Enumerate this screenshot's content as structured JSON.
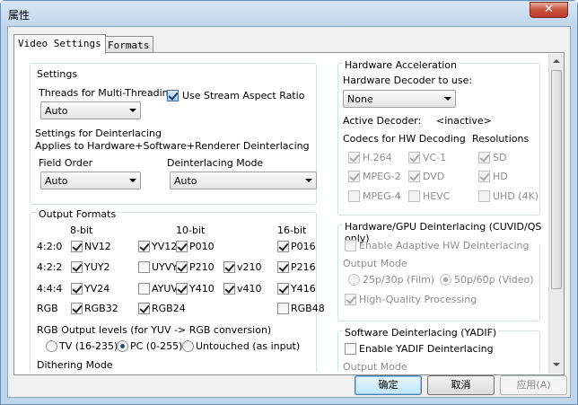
{
  "window": {
    "title": "属性",
    "close_glyph": "✕"
  },
  "tabs": [
    {
      "label": "Video Settings",
      "active": true
    },
    {
      "label": "Formats",
      "active": false
    }
  ],
  "settings": {
    "heading": "Settings",
    "threads_label": "Threads for Multi-Threading",
    "threads_value": "Auto",
    "stream_aspect_label": "Use Stream Aspect Ratio",
    "stream_aspect_checked": true,
    "deint_line1": "Settings for Deinterlacing",
    "deint_line2": "Applies to Hardware+Software+Renderer Deinterlacing",
    "field_order_label": "Field Order",
    "field_order_value": "Auto",
    "deint_mode_label": "Deinterlacing Mode",
    "deint_mode_value": "Auto"
  },
  "output_formats": {
    "heading": "Output Formats",
    "col_8bit": "8-bit",
    "col_10bit": "10-bit",
    "col_16bit": "16-bit",
    "rows": [
      {
        "label": "4:2:0",
        "items": [
          {
            "name": "NV12",
            "checked": true
          },
          {
            "name": "YV12",
            "checked": true
          },
          {
            "name": "P010",
            "checked": true
          },
          {
            "name": "P016",
            "checked": true
          }
        ]
      },
      {
        "label": "4:2:2",
        "items": [
          {
            "name": "YUY2",
            "checked": true
          },
          {
            "name": "UYVY",
            "checked": false
          },
          {
            "name": "P210",
            "checked": true
          },
          {
            "name": "v210",
            "checked": true
          },
          {
            "name": "P216",
            "checked": true
          }
        ]
      },
      {
        "label": "4:4:4",
        "items": [
          {
            "name": "YV24",
            "checked": true
          },
          {
            "name": "AYUV",
            "checked": false
          },
          {
            "name": "Y410",
            "checked": true
          },
          {
            "name": "v410",
            "checked": true
          },
          {
            "name": "Y416",
            "checked": true
          }
        ]
      },
      {
        "label": "RGB",
        "items": [
          {
            "name": "RGB32",
            "checked": true
          },
          {
            "name": "RGB24",
            "checked": true
          },
          {
            "name": "RGB48",
            "checked": false
          }
        ]
      }
    ],
    "rgb_levels_label": "RGB Output levels (for YUV -> RGB conversion)",
    "rgb_levels_options": [
      {
        "label": "TV (16-235)",
        "selected": false
      },
      {
        "label": "PC (0-255)",
        "selected": true
      },
      {
        "label": "Untouched (as input)",
        "selected": false
      }
    ],
    "dithering_label": "Dithering Mode"
  },
  "hw_accel": {
    "heading": "Hardware Acceleration",
    "decoder_label": "Hardware Decoder to use:",
    "decoder_value": "None",
    "active_decoder_label": "Active Decoder:",
    "active_decoder_value": "<inactive>",
    "codecs_label": "Codecs for HW Decoding",
    "resolutions_label": "Resolutions",
    "codecs": [
      {
        "name": "H.264",
        "checked": true
      },
      {
        "name": "VC-1",
        "checked": true
      },
      {
        "name": "MPEG-2",
        "checked": true
      },
      {
        "name": "DVD",
        "checked": true
      },
      {
        "name": "MPEG-4",
        "checked": false
      },
      {
        "name": "HEVC",
        "checked": false
      }
    ],
    "resolutions": [
      {
        "name": "SD",
        "checked": true
      },
      {
        "name": "HD",
        "checked": true
      },
      {
        "name": "UHD (4K)",
        "checked": false
      }
    ]
  },
  "hw_deint": {
    "heading": "Hardware/GPU Deinterlacing (CUVID/QS only)",
    "enable_label": "Enable Adaptive HW Deinterlacing",
    "enable_checked": false,
    "output_mode_label": "Output Mode",
    "mode_film": "25p/30p (Film)",
    "mode_video": "50p/60p (Video)",
    "mode_video_selected": true,
    "hq_label": "High-Quality Processing",
    "hq_checked": true
  },
  "sw_deint": {
    "heading": "Software Deinterlacing (YADIF)",
    "enable_label": "Enable YADIF Deinterlacing",
    "enable_checked": false,
    "output_mode_label": "Output Mode"
  },
  "buttons": {
    "ok": "确定",
    "cancel": "取消",
    "apply": "应用(A)"
  }
}
